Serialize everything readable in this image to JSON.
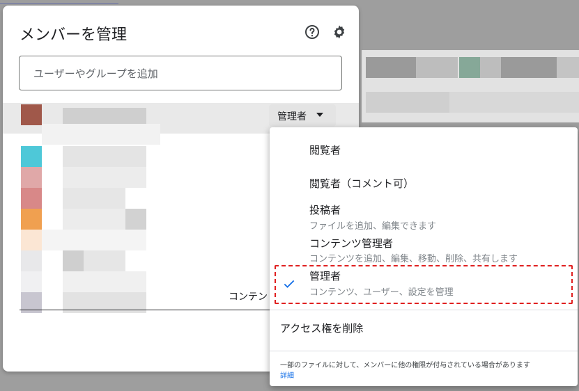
{
  "dialog": {
    "title": "メンバーを管理",
    "help_icon": "help-circle-icon",
    "settings_icon": "gear-icon",
    "search_placeholder": "ユーザーやグループを追加",
    "current_role_button": "管理者",
    "partial_row_label": "コンテン"
  },
  "role_menu": {
    "options": [
      {
        "title": "閲覧者",
        "subtitle": ""
      },
      {
        "title": "閲覧者（コメント可）",
        "subtitle": ""
      },
      {
        "title": "投稿者",
        "subtitle": "ファイルを追加、編集できます"
      },
      {
        "title": "コンテンツ管理者",
        "subtitle": "コンテンツを追加、編集、移動、削除、共有します"
      },
      {
        "title": "管理者",
        "subtitle": "コンテンツ、ユーザー、設定を管理",
        "selected": true
      }
    ],
    "remove_access": "アクセス権を削除",
    "footer_note": "一部のファイルに対して、メンバーに他の権限が付与されている場合があります",
    "footer_link": "詳細"
  },
  "colors": {
    "accent_check": "#1a73e8",
    "highlight_border": "#e02020",
    "avatar_swatches": [
      "#a0584a",
      "#4ec8d8",
      "#e0a8a8",
      "#d88888",
      "#f0a050",
      "#fbe6d4",
      "#e8e8ea",
      "#c8c6d0"
    ]
  }
}
